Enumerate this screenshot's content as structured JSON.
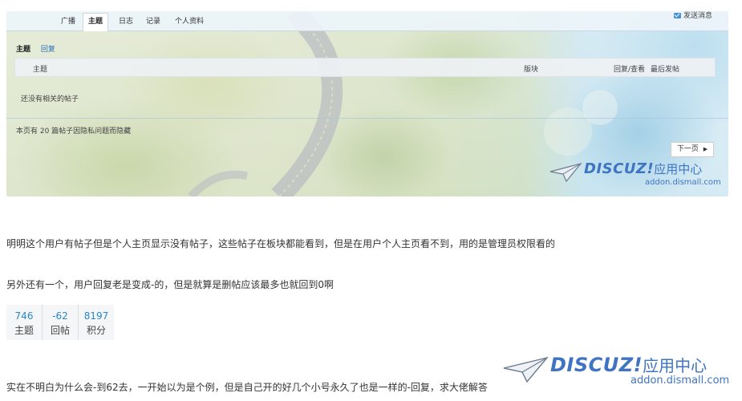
{
  "screenshot": {
    "tabs": [
      {
        "label": "广播"
      },
      {
        "label": "主题"
      },
      {
        "label": "日志"
      },
      {
        "label": "记录"
      },
      {
        "label": "个人资料"
      }
    ],
    "active_tab": "主题",
    "send_message": "发送消息",
    "subtabs": {
      "topics": "主题",
      "replies": "回复"
    },
    "table_header": {
      "topic": "主题",
      "forum": "版块",
      "replies_views": "回复/查看",
      "last_post": "最后发帖"
    },
    "empty_message": "还没有相关的帖子",
    "hidden_notice": "本页有 20 篇帖子因隐私问题而隐藏",
    "next_page": "下一页",
    "watermark": {
      "brand": "DISCUZ!",
      "cn": "应用中心",
      "url": "addon.dismall.com"
    }
  },
  "post": {
    "paragraph1": "明明这个用户有帖子但是个人主页显示没有帖子，这些帖子在板块都能看到，但是在用户个人主页看不到，用的是管理员权限看的",
    "paragraph2": "另外还有一个，用户回复老是变成-的，但是就算是删帖应该最多也就回到0啊",
    "stats": [
      {
        "value": "746",
        "label": "主题"
      },
      {
        "value": "-62",
        "label": "回帖"
      },
      {
        "value": "8197",
        "label": "积分"
      }
    ],
    "paragraph3": "实在不明白为什么会-到62去，一开始以为是个例，但是自己开的好几个小号永久了也是一样的-回复，求大佬解答"
  },
  "watermark": {
    "brand": "DISCUZ!",
    "cn": "应用中心",
    "url": "addon.dismall.com"
  },
  "colors": {
    "link": "#2a86c8",
    "brand": "#3f74c2"
  }
}
